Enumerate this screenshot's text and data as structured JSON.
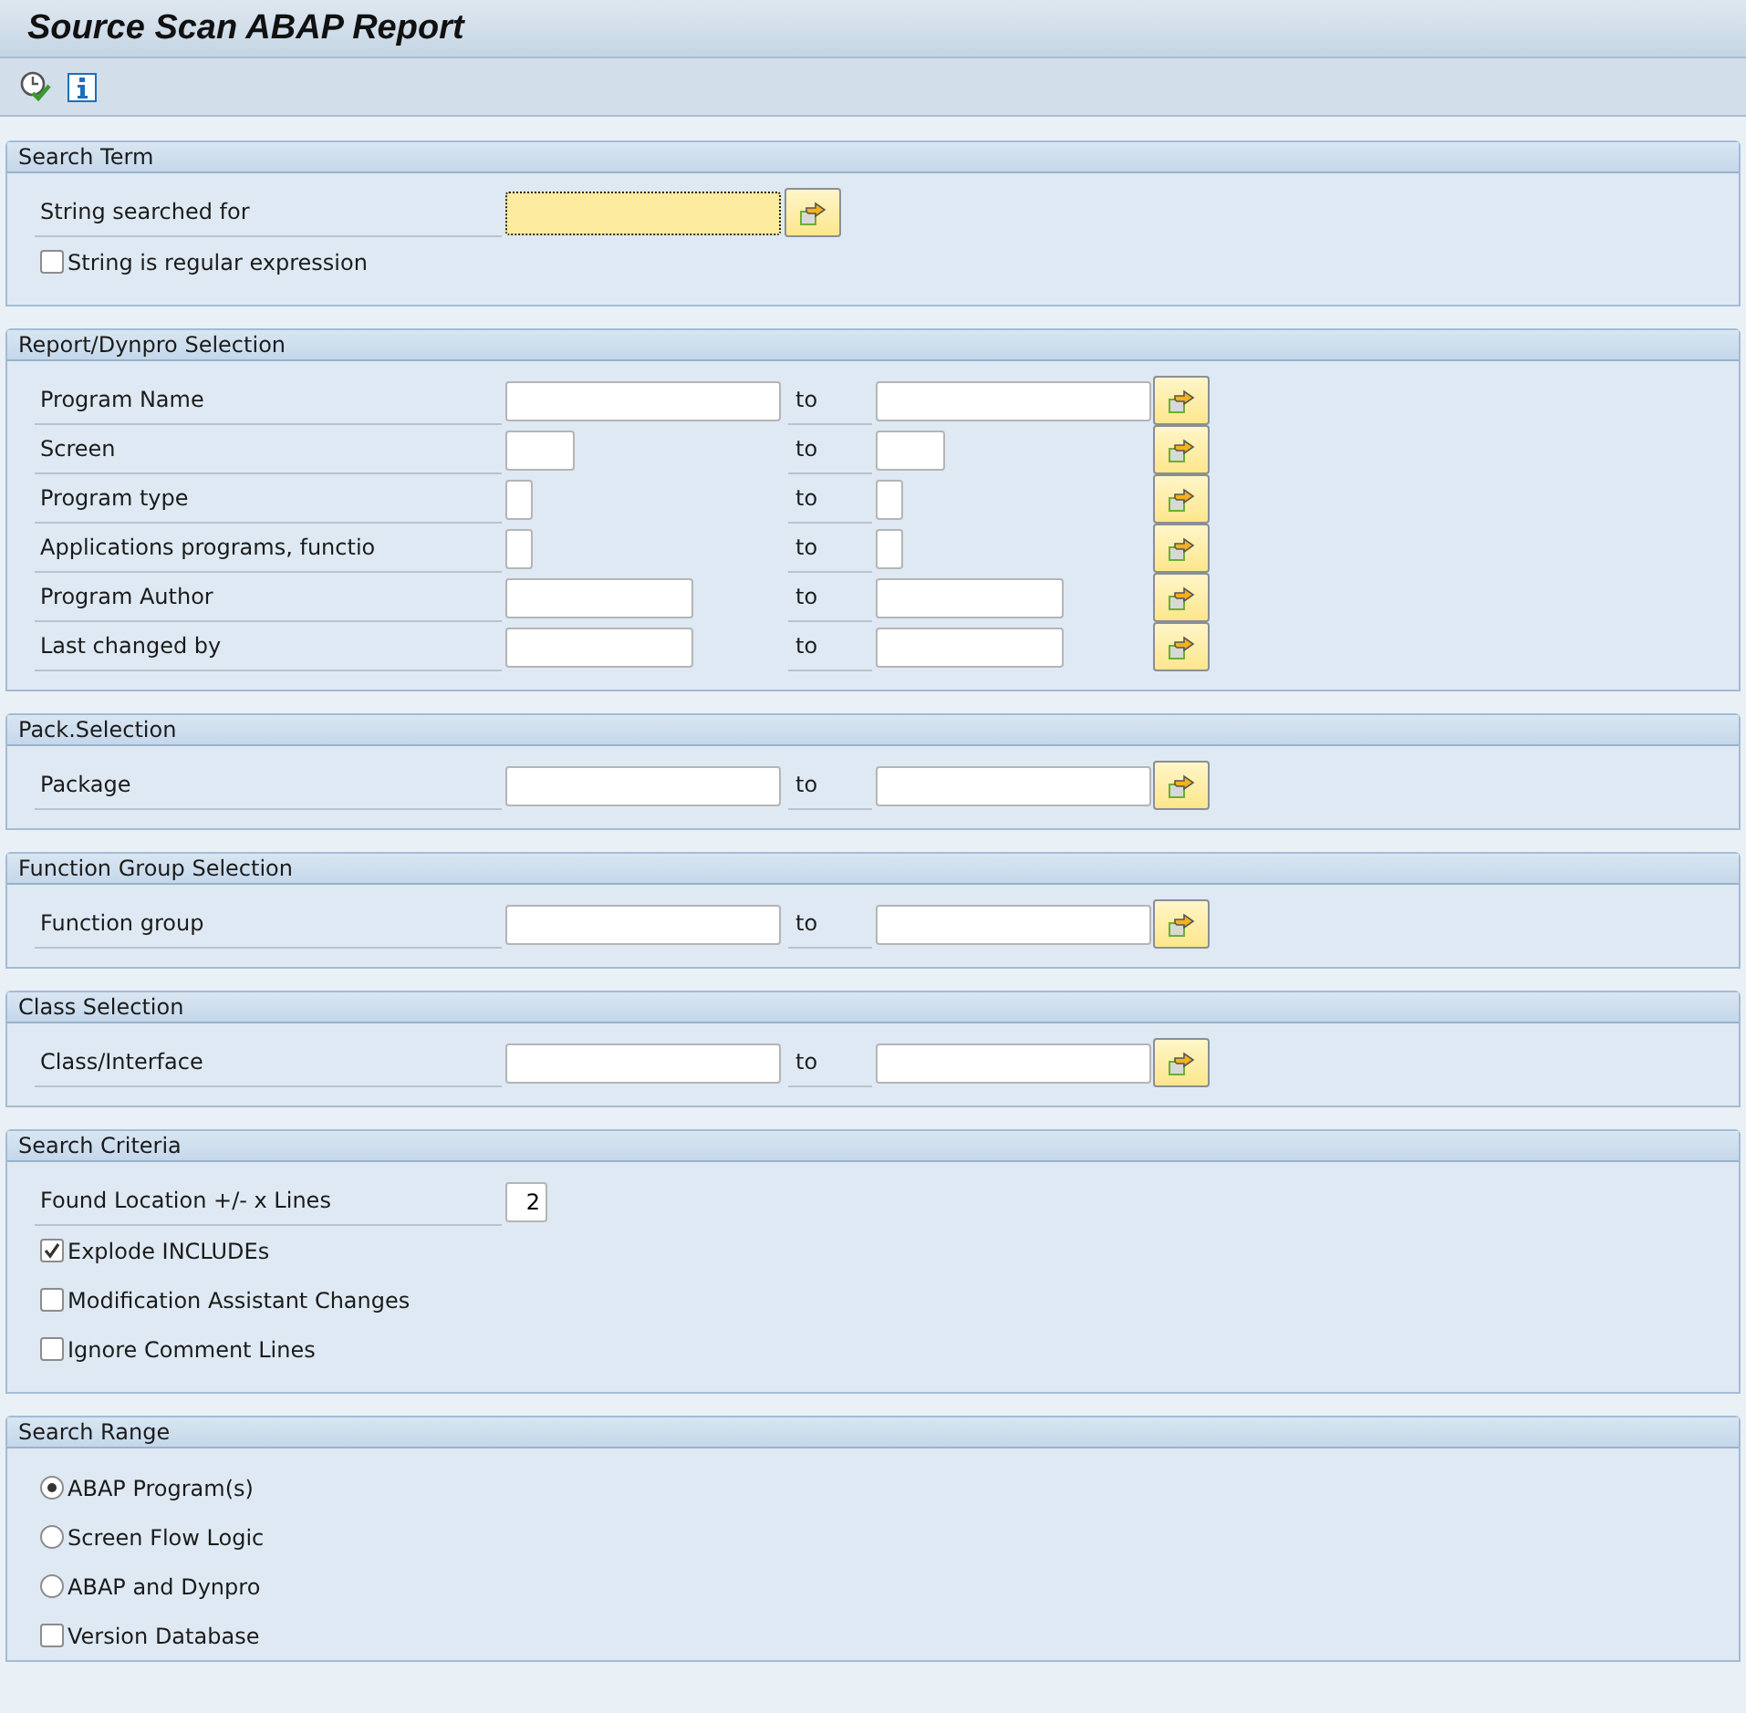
{
  "window": {
    "title": "Source Scan ABAP Report"
  },
  "toolbar": [
    {
      "kind": "execute"
    },
    {
      "kind": "info"
    }
  ],
  "groups": [
    {
      "title": "Search Term",
      "items": [
        {
          "kind": "longfield",
          "label": "String searched for",
          "value": "",
          "focused": true,
          "range": false
        },
        {
          "kind": "checkbox",
          "label": "String is regular expression",
          "checked": false
        }
      ]
    },
    {
      "title": "Report/Dynpro Selection",
      "items": [
        {
          "kind": "longfield",
          "label": "Program Name",
          "value": "",
          "focused": false,
          "range": true,
          "to": "to"
        },
        {
          "kind": "shortfield",
          "label": "Screen",
          "value": "",
          "focused": false,
          "range": true,
          "to": "to"
        },
        {
          "kind": "tinyfield",
          "label": "Program type",
          "value": "",
          "focused": false,
          "range": true,
          "to": "to"
        },
        {
          "kind": "tinyfield",
          "label": "Applications programs, functio",
          "value": "",
          "focused": false,
          "range": true,
          "to": "to"
        },
        {
          "kind": "mediumfield",
          "label": "Program Author",
          "value": "",
          "focused": false,
          "range": true,
          "to": "to"
        },
        {
          "kind": "mediumfield",
          "label": "Last changed by",
          "value": "",
          "focused": false,
          "range": true,
          "to": "to"
        }
      ]
    },
    {
      "title": "Pack.Selection",
      "items": [
        {
          "kind": "longfield",
          "label": "Package",
          "value": "",
          "focused": false,
          "range": true,
          "to": "to"
        }
      ]
    },
    {
      "title": "Function Group Selection",
      "items": [
        {
          "kind": "longfield",
          "label": "Function group",
          "value": "",
          "focused": false,
          "range": true,
          "to": "to"
        }
      ]
    },
    {
      "title": "Class Selection",
      "items": [
        {
          "kind": "longfield",
          "label": "Class/Interface",
          "value": "",
          "focused": false,
          "range": true,
          "to": "to"
        }
      ]
    },
    {
      "title": "Search Criteria",
      "items": [
        {
          "kind": "numberfield",
          "label": "Found Location +/- x Lines",
          "value": "2",
          "focused": false,
          "range": false,
          "button": false
        },
        {
          "kind": "checkbox",
          "label": "Explode INCLUDEs",
          "checked": true
        },
        {
          "kind": "checkbox",
          "label": "Modification Assistant Changes",
          "checked": false
        },
        {
          "kind": "checkbox",
          "label": "Ignore Comment Lines",
          "checked": false
        }
      ]
    },
    {
      "title": "Search Range",
      "items": [
        {
          "kind": "radio",
          "label": "ABAP Program(s)",
          "selected": true
        },
        {
          "kind": "radio",
          "label": "Screen Flow Logic",
          "selected": false
        },
        {
          "kind": "radio",
          "label": "ABAP and Dynpro",
          "selected": false
        },
        {
          "kind": "checkbox",
          "label": "Version Database",
          "checked": false
        }
      ]
    }
  ]
}
